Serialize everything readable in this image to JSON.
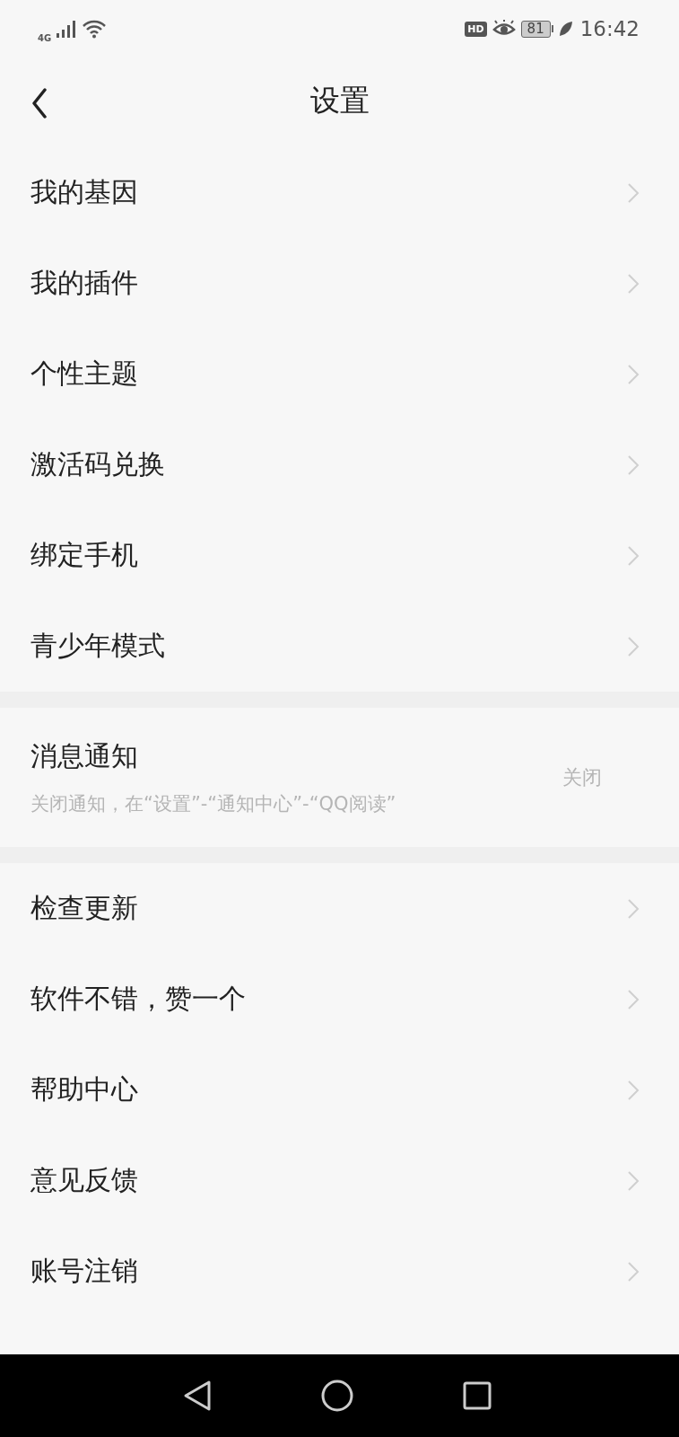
{
  "status_bar": {
    "network": "4G",
    "hd": "HD",
    "battery": "81",
    "time": "16:42"
  },
  "header": {
    "title": "设置"
  },
  "groups": [
    {
      "items": [
        {
          "kind": "link",
          "label": "我的基因"
        },
        {
          "kind": "link",
          "label": "我的插件"
        },
        {
          "kind": "link",
          "label": "个性主题"
        },
        {
          "kind": "link",
          "label": "激活码兑换"
        },
        {
          "kind": "link",
          "label": "绑定手机"
        },
        {
          "kind": "link",
          "label": "青少年模式"
        }
      ]
    },
    {
      "items": [
        {
          "kind": "notice",
          "label": "消息通知",
          "description": "关闭通知，在“设置”-“通知中心”-“QQ阅读”",
          "value": "关闭"
        }
      ]
    },
    {
      "items": [
        {
          "kind": "link",
          "label": "检查更新"
        },
        {
          "kind": "link",
          "label": "软件不错，赞一个"
        },
        {
          "kind": "link",
          "label": "帮助中心"
        },
        {
          "kind": "link",
          "label": "意见反馈"
        },
        {
          "kind": "link",
          "label": "账号注销"
        }
      ]
    }
  ]
}
